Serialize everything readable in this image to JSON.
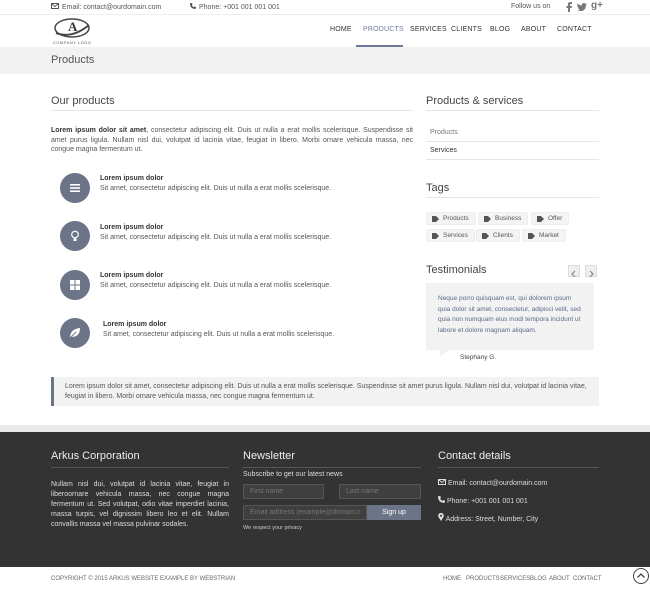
{
  "topbar": {
    "email": "Email: contact@ourdomain.com",
    "phone": "Phone: +001 001 001 001",
    "follow": "Follow us on"
  },
  "logo": {
    "letter": "A",
    "text": "COMPANY LOGO"
  },
  "nav": [
    "HOME",
    "PRODUCTS",
    "SERVICES",
    "CLIENTS",
    "BLOG",
    "ABOUT",
    "CONTACT"
  ],
  "page_title": "Products",
  "main": {
    "heading": "Our products",
    "intro_bold": "Lorem ipsum dolor sit amet",
    "intro_rest": ", consectetur adipiscing elit. Duis ut nulla a erat mollis scelerisque. Suspendisse sit amet purus ligula. Nullam nisl dui, volutpat id lacinia vitae, feugiat in libero. Morbi ornare vehicula massa, nec congue magna fermentum ut.",
    "features": [
      {
        "title": "Lorem ipsum dolor",
        "text": "Sit amet, consectetur adipiscing elit. Duis ut nulla a erat mollis scelerisque.",
        "icon": "list-icon"
      },
      {
        "title": "Lorem ipsum dolor",
        "text": "Sit amet, consectetur adipiscing elit. Duis ut nulla a erat mollis scelerisque.",
        "icon": "lightbulb-icon"
      },
      {
        "title": "Lorem ipsum dolor",
        "text": "Sit amet, consectetur adipiscing elit. Duis ut nulla a erat mollis scelerisque.",
        "icon": "grid-icon"
      },
      {
        "title": "Lorem ipsum dolor",
        "text": "Sit amet, consectetur adipiscing elit. Duis ut nulla a erat mollis scelerisque.",
        "icon": "leaf-icon"
      }
    ],
    "quote": "Lorem ipsum dolor sit amet, consectetur adipiscing elit. Duis ut nulla a erat mollis scelerisque. Suspendisse sit amet purus ligula. Nullam nisl dui, volutpat id lacinia vitae, feugiat in libero. Morbi ornare vehicula massa, nec congue magna fermentum ut."
  },
  "sidebar": {
    "ps_heading": "Products & services",
    "ps_items": [
      "Products",
      "Services"
    ],
    "tags_heading": "Tags",
    "tags": [
      "Products",
      "Business",
      "Offer",
      "Services",
      "Clients",
      "Market"
    ],
    "testimonials_heading": "Testimonials",
    "testimonial_text": "Neque porro quisquam est, qui dolorem ipsum quia dolor sit amet, consectetur, adipisci velit, sed quia non numquam eius modi tempora incidunt ut labore et dolore magnam aliquam.",
    "testimonial_author": "Stephany G."
  },
  "footer": {
    "about_heading": "Arkus Corporation",
    "about_text": "Nullam nisl dui, volutpat id lacinia vitae, feugiat in liberoornare vehicula massa, nec congue magna fermentum ut. Sed volutpat, odio vitae imperdiet lacinia, massa turpis, vel dignissim libero leo et elit. Nullam convallis massa vel massa pulvinar sodales.",
    "newsletter_heading": "Newsletter",
    "newsletter_sub": "Subscribe to get our latest news",
    "first_name": "First name",
    "last_name": "Last name",
    "email_ph": "Email address (example@domain.com)",
    "signup": "Sign up",
    "privacy": "We respect your privacy",
    "contact_heading": "Contact details",
    "contact_email": "Email: contact@ourdomain.com",
    "contact_phone": "Phone: +001 001 001 001",
    "contact_address": "Address: Street, Number, City"
  },
  "bottom": {
    "copyright": "COPYRIGHT © 2015 ARKUS WEBSITE EXAMPLE BY WEBSTRIAN",
    "links": [
      "HOME",
      "PRODUCTS",
      "SERVICES",
      "BLOG",
      "ABOUT",
      "CONTACT"
    ]
  }
}
